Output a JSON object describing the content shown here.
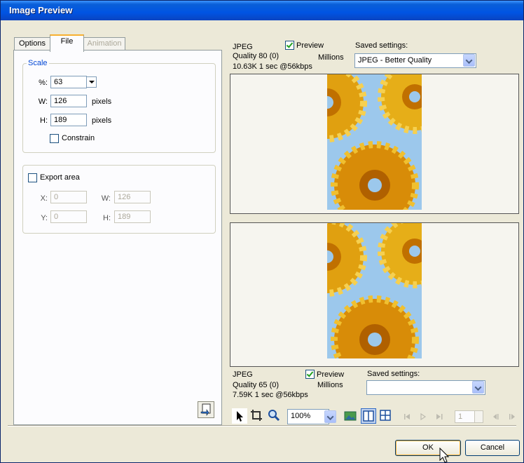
{
  "window": {
    "title": "Image Preview"
  },
  "tabs": [
    {
      "label": "Options",
      "state": "normal"
    },
    {
      "label": "File",
      "state": "active"
    },
    {
      "label": "Animation",
      "state": "disabled"
    }
  ],
  "scale": {
    "legend": "Scale",
    "percent_label": "%:",
    "percent_value": "63",
    "w_label": "W:",
    "w_value": "126",
    "w_unit": "pixels",
    "h_label": "H:",
    "h_value": "189",
    "h_unit": "pixels",
    "constrain_label": "Constrain",
    "constrain_checked": false
  },
  "export_area": {
    "label": "Export area",
    "checked": false,
    "x_label": "X:",
    "x_value": "0",
    "y_label": "Y:",
    "y_value": "0",
    "w_label": "W:",
    "w_value": "126",
    "h_label": "H:",
    "h_value": "189"
  },
  "preview_top": {
    "format": "JPEG",
    "quality": "Quality 80 (0)",
    "size_time": "10.63K  1 sec @56kbps",
    "preview_label": "Preview",
    "preview_checked": true,
    "colors": "Millions",
    "saved_settings_label": "Saved settings:",
    "saved_settings_value": "JPEG - Better Quality"
  },
  "preview_bottom": {
    "format": "JPEG",
    "quality": "Quality 65 (0)",
    "size_time": "7.59K  1 sec @56kbps",
    "preview_label": "Preview",
    "preview_checked": true,
    "colors": "Millions",
    "saved_settings_label": "Saved settings:",
    "saved_settings_value": ""
  },
  "toolbar": {
    "zoom": "100%",
    "frame": "1"
  },
  "buttons": {
    "ok": "OK",
    "cancel": "Cancel"
  },
  "colors": {
    "titlebar": "#0054e3",
    "tab_highlight": "#f8b030",
    "group_legend": "#0046d5",
    "gear_gold": "#e0a010",
    "gear_sky": "#9cc8ec"
  },
  "icons": [
    "export-wizard-icon",
    "pointer-tool-icon",
    "crop-tool-icon",
    "zoom-tool-icon",
    "preview-image-icon",
    "two-up-icon",
    "four-up-icon",
    "first-frame-icon",
    "play-icon",
    "last-frame-icon",
    "prev-frame-icon",
    "next-frame-icon",
    "cursor-icon"
  ]
}
